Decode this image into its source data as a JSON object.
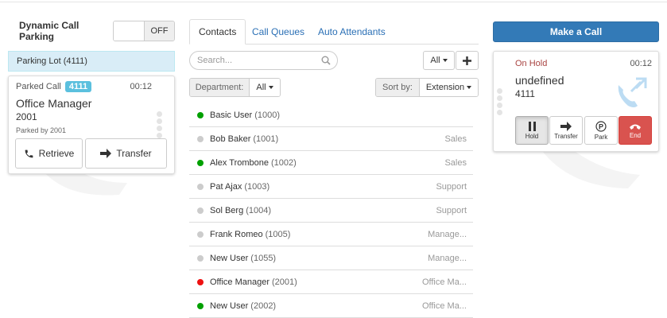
{
  "left": {
    "dynamic_label": "Dynamic Call Parking",
    "toggle_state": "OFF",
    "lot_header": "Parking Lot (4111)",
    "parked": {
      "label": "Parked Call",
      "badge": "4111",
      "time": "00:12",
      "name": "Office Manager",
      "ext": "2001",
      "parked_by": "Parked by 2001",
      "retrieve_label": "Retrieve",
      "transfer_label": "Transfer"
    }
  },
  "tabs": [
    {
      "label": "Contacts",
      "active": true
    },
    {
      "label": "Call Queues",
      "active": false
    },
    {
      "label": "Auto Attendants",
      "active": false
    }
  ],
  "search": {
    "placeholder": "Search..."
  },
  "filter_all": "All",
  "add_icon": "plus-icon",
  "department": {
    "label": "Department:",
    "value": "All"
  },
  "sort": {
    "label": "Sort by:",
    "value": "Extension"
  },
  "colors": {
    "online": "#00a000",
    "offline": "#cccccc",
    "busy": "#ee1111",
    "primary": "#337ab7",
    "danger": "#d9534f",
    "on_hold": "#a94442"
  },
  "contacts": [
    {
      "name": "Basic User",
      "ext": "(1000)",
      "dept": "",
      "status": "online"
    },
    {
      "name": "Bob Baker",
      "ext": "(1001)",
      "dept": "Sales",
      "status": "offline"
    },
    {
      "name": "Alex Trombone",
      "ext": "(1002)",
      "dept": "Sales",
      "status": "online"
    },
    {
      "name": "Pat Ajax",
      "ext": "(1003)",
      "dept": "Support",
      "status": "offline"
    },
    {
      "name": "Sol Berg",
      "ext": "(1004)",
      "dept": "Support",
      "status": "offline"
    },
    {
      "name": "Frank Romeo",
      "ext": "(1005)",
      "dept": "Manage...",
      "status": "offline"
    },
    {
      "name": "New User",
      "ext": "(1055)",
      "dept": "Manage...",
      "status": "offline"
    },
    {
      "name": "Office Manager",
      "ext": "(2001)",
      "dept": "Office Ma...",
      "status": "busy"
    },
    {
      "name": "New User",
      "ext": "(2002)",
      "dept": "Office Ma...",
      "status": "online"
    }
  ],
  "make_call_label": "Make a Call",
  "active_call": {
    "status": "On Hold",
    "time": "00:12",
    "name": "undefined",
    "ext": "4111",
    "buttons": {
      "hold": "Hold",
      "transfer": "Transfer",
      "park": "Park",
      "end": "End"
    }
  }
}
